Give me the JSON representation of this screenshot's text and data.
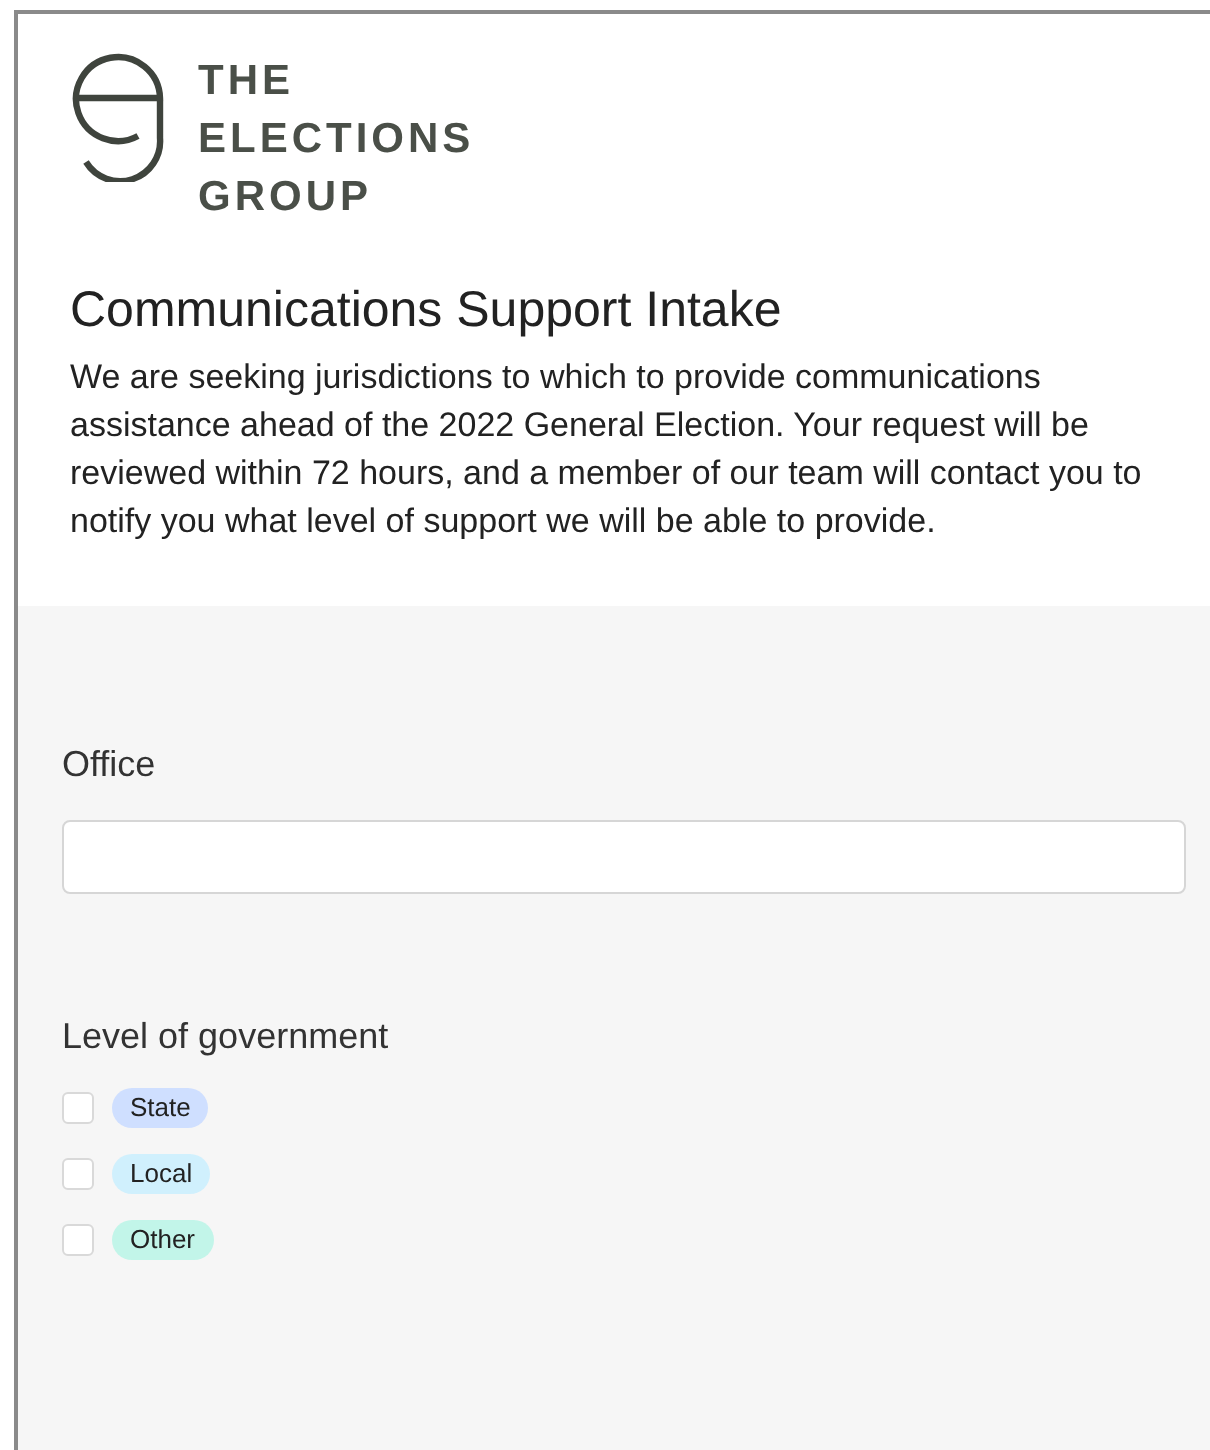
{
  "logo": {
    "lines": [
      "THE",
      "ELECTIONS",
      "GROUP"
    ]
  },
  "form": {
    "title": "Communications Support Intake",
    "description": "We are seeking jurisdictions to which to provide communications assistance ahead of the 2022 General Election. Your request will be reviewed within 72 hours, and a member of our team will contact you to notify you what level of support we will be able to provide."
  },
  "fields": [
    {
      "kind": "text",
      "label": "Office"
    },
    {
      "kind": "checkboxes",
      "label": "Level of government",
      "options": [
        {
          "label": "State",
          "checked": false,
          "color": "#cfdfff"
        },
        {
          "label": "Local",
          "checked": false,
          "color": "#d0f0fd"
        },
        {
          "label": "Other",
          "checked": false,
          "color": "#c2f5e9"
        }
      ]
    }
  ]
}
